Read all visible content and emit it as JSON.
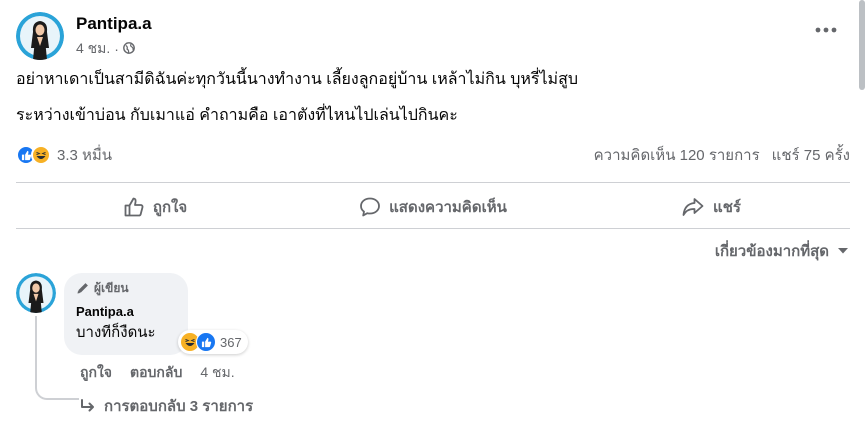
{
  "post": {
    "author": "Pantipa.a",
    "time": "4 ชม.",
    "separator": "·",
    "lines": [
      "อย่าหาเดาเป็นสามีดิฉันค่ะทุกวันนี้นางทำงาน เลี้ยงลูกอยู่บ้าน เหล้าไม่กิน บุหรี่ไม่สูบ",
      "ระหว่างเข้าบ่อน กับเมาแอ่ คำถามคือ เอาตังที่ไหนไปเล่นไปกินคะ"
    ],
    "reaction_count": "3.3 หมื่น",
    "comments_count": "ความคิดเห็น 120 รายการ",
    "shares_count": "แชร์ 75 ครั้ง"
  },
  "actions": {
    "like": "ถูกใจ",
    "comment": "แสดงความคิดเห็น",
    "share": "แชร์"
  },
  "sort": {
    "label": "เกี่ยวข้องมากที่สุด"
  },
  "comment": {
    "badge": "ผู้เขียน",
    "author": "Pantipa.a",
    "text": "บางทีก็งืดนะ",
    "reaction_count": "367",
    "like": "ถูกใจ",
    "reply": "ตอบกลับ",
    "time": "4 ชม.",
    "replies": "การตอบกลับ 3 รายการ"
  },
  "icons": {
    "globe": "globe-icon",
    "more": "more-dots-icon",
    "like": "thumbs-up-icon",
    "comment": "speech-bubble-icon",
    "share": "share-arrow-icon",
    "dropdown": "caret-down-icon",
    "pencil": "pencil-icon",
    "reply_arrow": "reply-arrow-icon"
  },
  "colors": {
    "like_blue": "#1877f2",
    "haha_yellow": "#f7b125",
    "muted_text": "#65676b",
    "bubble_bg": "#f0f2f5"
  }
}
